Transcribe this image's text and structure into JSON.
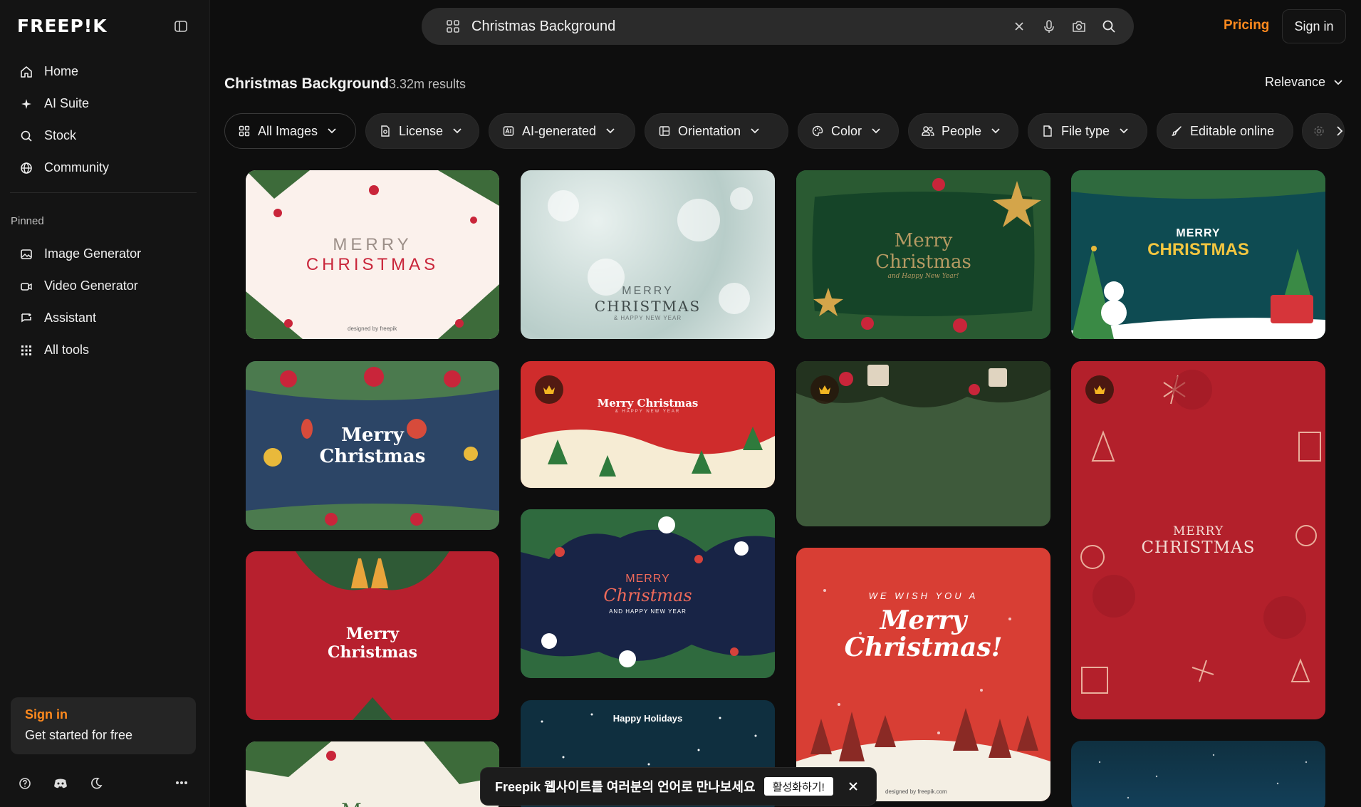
{
  "brand": {
    "logo_text": "FREEP!K"
  },
  "sidebar": {
    "nav": [
      {
        "label": "Home",
        "icon": "home-icon"
      },
      {
        "label": "AI Suite",
        "icon": "sparkle-icon"
      },
      {
        "label": "Stock",
        "icon": "search-icon"
      },
      {
        "label": "Community",
        "icon": "globe-icon"
      }
    ],
    "pinned_label": "Pinned",
    "pinned": [
      {
        "label": "Image Generator",
        "icon": "image-icon"
      },
      {
        "label": "Video Generator",
        "icon": "video-icon"
      },
      {
        "label": "Assistant",
        "icon": "chat-icon"
      },
      {
        "label": "All tools",
        "icon": "grid-icon"
      }
    ],
    "signin_card": {
      "title": "Sign in",
      "subtitle": "Get started for free"
    }
  },
  "search": {
    "value": "Christmas Background",
    "placeholder": "Christmas Background"
  },
  "topbar": {
    "pricing": "Pricing",
    "signin": "Sign in"
  },
  "results": {
    "title": "Christmas Background",
    "count": "3.32m results",
    "sort": "Relevance"
  },
  "filters": [
    {
      "label": "All Images"
    },
    {
      "label": "License"
    },
    {
      "label": "AI-generated"
    },
    {
      "label": "Orientation"
    },
    {
      "label": "Color"
    },
    {
      "label": "People"
    },
    {
      "label": "File type"
    },
    {
      "label": "Editable online"
    }
  ],
  "cards": [
    {
      "line1": "MERRY",
      "line2": "CHRISTMAS",
      "note": "designed by freepik"
    },
    {
      "line1": "MERRY",
      "line2": "CHRISTMAS",
      "line3": "& HAPPY NEW YEAR"
    },
    {
      "line1": "Merry",
      "line2": "Christmas",
      "line3": "and Happy New Year!"
    },
    {
      "line1": "MERRY",
      "line2": "CHRISTMAS"
    },
    {
      "line1": "Merry",
      "line2": "Christmas"
    },
    {
      "line1": "Merry Christmas",
      "line2": "& HAPPY NEW YEAR"
    },
    {
      "line1": ""
    },
    {
      "line1": "MERRY",
      "line2": "CHRISTMAS"
    },
    {
      "line1": "Merry",
      "line2": "Christmas"
    },
    {
      "line1": "MERRY",
      "line2": "Christmas",
      "line3": "AND HAPPY NEW YEAR"
    },
    {
      "line1": "WE WISH YOU A",
      "line2": "Merry",
      "line3": "Christmas!",
      "note": "designed by freepik.com"
    },
    {
      "line1": "Merry"
    },
    {
      "line1": "Happy Holidays"
    },
    {
      "line1": ""
    }
  ],
  "toast": {
    "message": "Freepik 웹사이트를 여러분의 언어로 만나보세요",
    "action": "활성화하기!"
  },
  "colors": {
    "accent": "#ff8a1e",
    "bg": "#0e0e0e",
    "sidebar": "#141414"
  }
}
